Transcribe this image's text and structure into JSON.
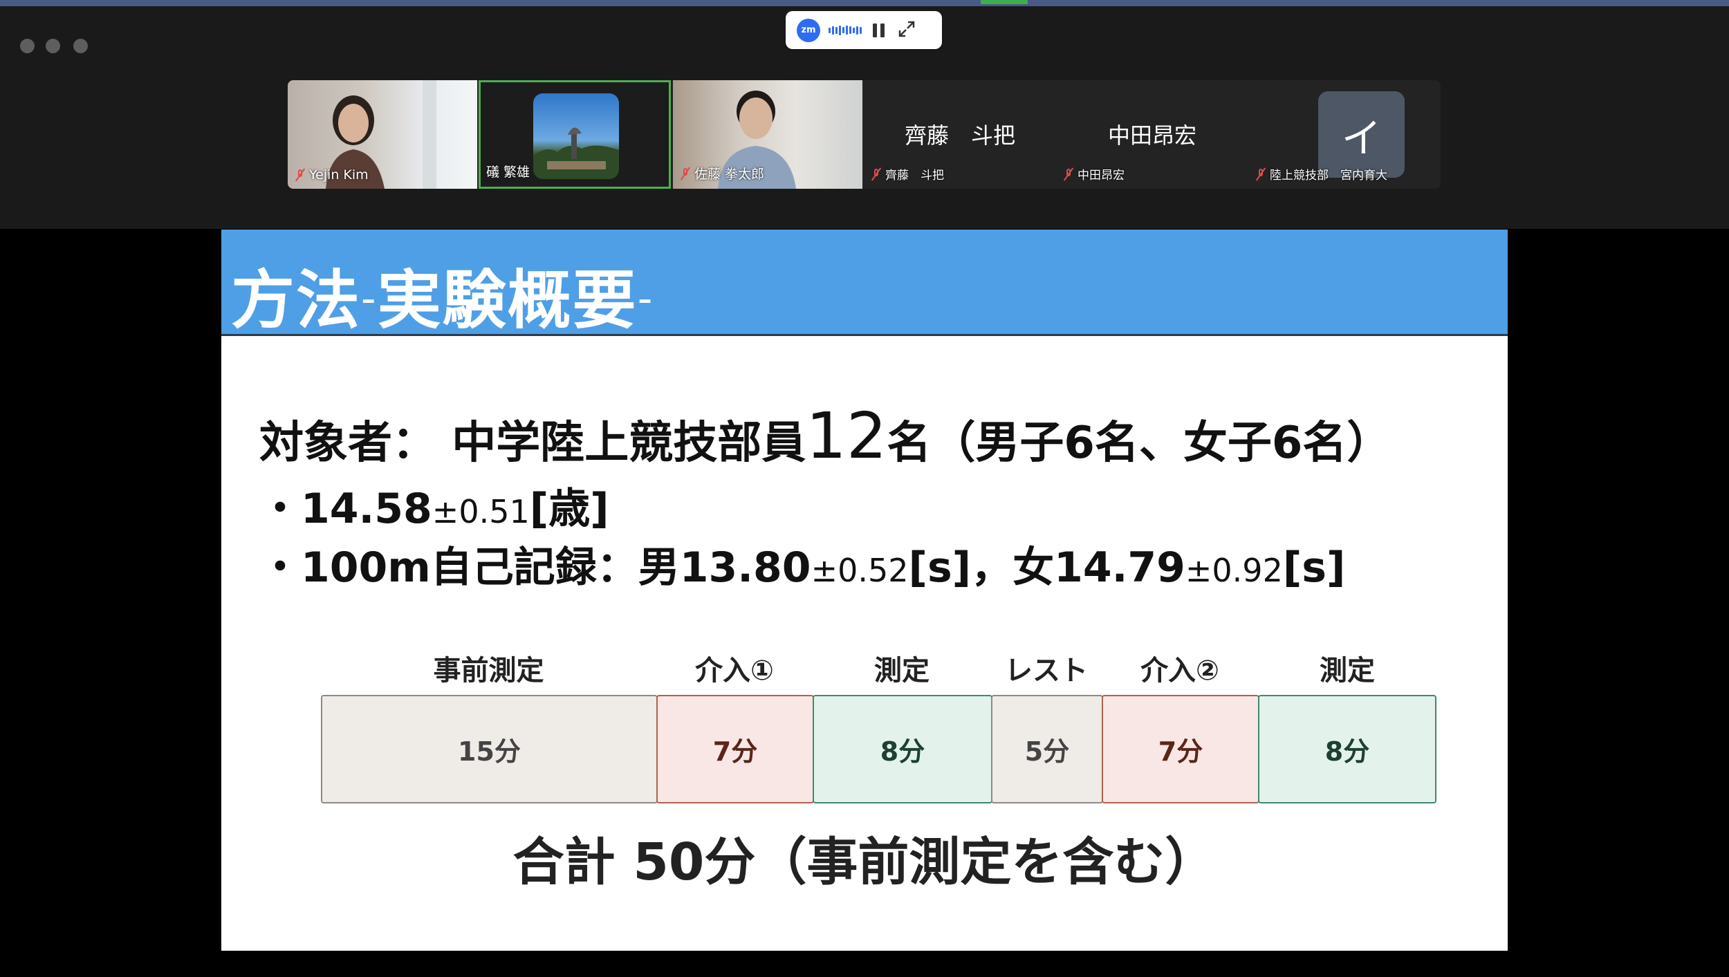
{
  "meeting_bar": {
    "logo": "zm",
    "icons": [
      "audio-wave-icon",
      "pause-icon",
      "expand-icon"
    ]
  },
  "participants": [
    {
      "name": "Yejin Kim",
      "muted": true,
      "video": true
    },
    {
      "name": "礒 繁雄",
      "muted": false,
      "video": true,
      "active_speaker": true
    },
    {
      "name": "佐藤 拳太郎",
      "muted": true,
      "video": true
    },
    {
      "display": "齊藤　斗把",
      "name": "齊藤　斗把",
      "muted": true,
      "video": false
    },
    {
      "display": "中田昂宏",
      "name": "中田昂宏",
      "muted": true,
      "video": false
    },
    {
      "initial": "イ",
      "name": "陸上競技部　宮内育大",
      "muted": true,
      "video": false
    }
  ],
  "slide": {
    "title_main": "方法",
    "title_dash1": "-",
    "title_sub": "実験概要",
    "title_dash2": "-",
    "line1_a": "対象者：  中学陸上競技部員",
    "line1_num": "12",
    "line1_b": "名（男子6名、女子6名）",
    "line2_a": "・14.58",
    "line2_b": "±0.51",
    "line2_c": "[歳]",
    "line3_a": "・100m自己記録：男13.80",
    "line3_b": "±0.52",
    "line3_c": "[s]，女14.79",
    "line3_d": "±0.92",
    "line3_e": "[s]",
    "timeline": [
      {
        "label": "事前測定",
        "duration": "15分",
        "style": "grey"
      },
      {
        "label": "介入①",
        "duration": "7分",
        "style": "red"
      },
      {
        "label": "測定",
        "duration": "8分",
        "style": "green"
      },
      {
        "label": "レスト",
        "duration": "5分",
        "style": "grey"
      },
      {
        "label": "介入②",
        "duration": "7分",
        "style": "red"
      },
      {
        "label": "測定",
        "duration": "8分",
        "style": "green"
      }
    ],
    "total": "合計 50分（事前測定を含む）"
  },
  "colors": {
    "slide_header": "#4e9fe6",
    "active_speaker_border": "#4caf50",
    "mute_icon": "#e24a4a",
    "zoom_blue": "#2d6cf2"
  }
}
